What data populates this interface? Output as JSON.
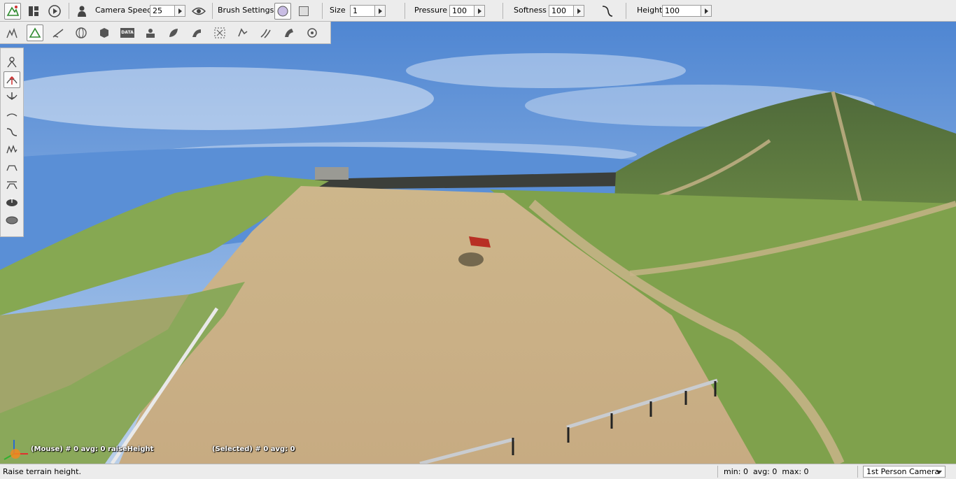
{
  "toolbar": {
    "camera_speed_label": "Camera Speed",
    "camera_speed_value": "25",
    "brush_settings_label": "Brush Settings",
    "size_label": "Size",
    "size_value": "1",
    "pressure_label": "Pressure",
    "pressure_value": "100",
    "softness_label": "Softness",
    "softness_value": "100",
    "height_label": "Height",
    "height_value": "100",
    "icons": [
      "terrain-editor-icon",
      "window-layout-icon",
      "play-icon",
      "camera-person-icon",
      "visibility-eye-icon",
      "circle-brush-icon",
      "square-brush-icon",
      "softness-curve-icon"
    ]
  },
  "second_toolbar": {
    "icons": [
      "select-object-icon",
      "terrain-editor-icon",
      "terrain-paint-icon",
      "sphere-object-icon",
      "mesh-object-icon",
      "datablock-icon",
      "decal-icon",
      "forest-icon",
      "road-icon",
      "navmesh-icon",
      "shape-icon",
      "river-icon",
      "mesh-road-icon",
      "particle-icon"
    ],
    "data_icon_label": "DATA"
  },
  "left_toolbar": {
    "tools": [
      "select-height-icon",
      "raise-height-icon",
      "lower-height-icon",
      "smooth-height-icon",
      "slope-icon",
      "noise-icon",
      "flatten-icon",
      "set-height-icon",
      "clear-terrain-icon",
      "set-empty-icon"
    ]
  },
  "viewport": {
    "mouse_info": "(Mouse) # 0  avg: 0 raiseHeight",
    "selected_info": "(Selected) # 0  avg: 0"
  },
  "status": {
    "message": "Raise terrain height.",
    "stats": "min: 0  avg: 0  max: 0",
    "camera_mode": "1st Person Camera"
  },
  "colors": {
    "accent": "#d03030",
    "sky": "#5a8fd6",
    "grass": "#7a9a48",
    "dirt": "#c9b48a"
  }
}
